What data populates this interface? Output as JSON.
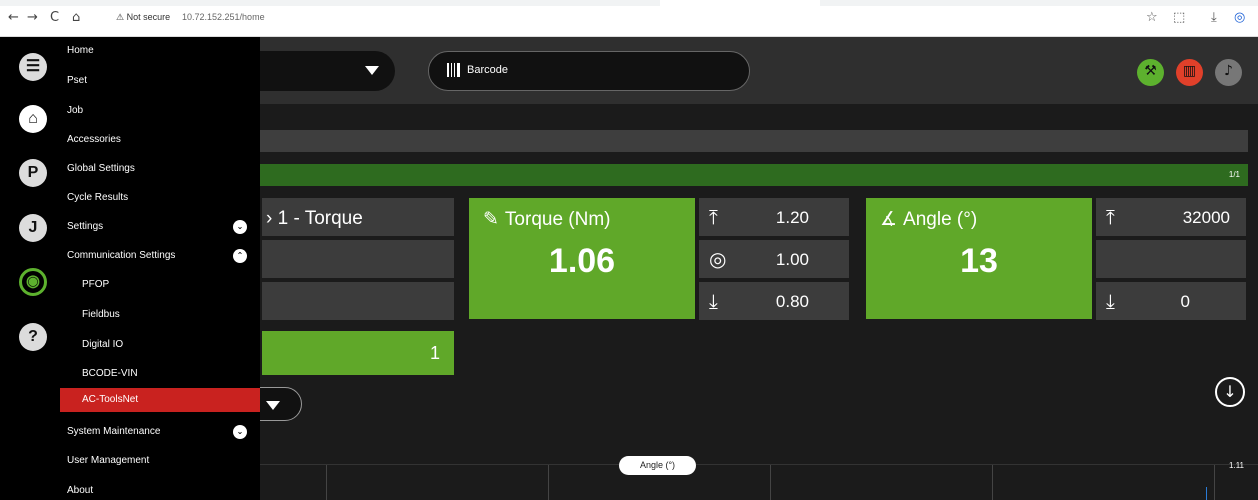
{
  "browser": {
    "back": "←",
    "forward": "→",
    "reload": "C",
    "home": "⌂",
    "security_label": "⚠ Not secure",
    "url": "10.72.152.251/home",
    "toolbar_icons": [
      "star-icon",
      "extensions-icon",
      "download-icon",
      "profile-icon"
    ]
  },
  "header": {
    "barcode_label": "Barcode"
  },
  "sidebar": {
    "rail": [
      "☰",
      "⌂",
      "P",
      "J",
      "◉",
      "?"
    ],
    "items": [
      {
        "label": "Home"
      },
      {
        "label": "Pset"
      },
      {
        "label": "Job"
      },
      {
        "label": "Accessories"
      },
      {
        "label": "Global Settings"
      },
      {
        "label": "Cycle Results"
      },
      {
        "label": "Settings"
      },
      {
        "label": "Communication Settings"
      },
      {
        "label": "PFOP"
      },
      {
        "label": "Fieldbus"
      },
      {
        "label": "Digital IO"
      },
      {
        "label": "BCODE-VIN"
      },
      {
        "label": "AC-ToolsNet"
      },
      {
        "label": "System Maintenance"
      },
      {
        "label": "User Management"
      },
      {
        "label": "About"
      }
    ]
  },
  "progress": {
    "count": "1/1"
  },
  "pset": {
    "title": "1 - Torque",
    "batch_count": "1"
  },
  "torque": {
    "label": "Torque (Nm)",
    "value": "1.06",
    "max": "1.20",
    "target": "1.00",
    "min": "0.80"
  },
  "angle": {
    "label": "Angle (°)",
    "value": "13",
    "max": "32000",
    "min": "0"
  },
  "chart": {
    "toggle_label": "Angle (°)",
    "y_tick": "1.11"
  },
  "colors": {
    "accent_green": "#60a829",
    "active_red": "#c9221f",
    "status_tool": "#5db12e",
    "status_factory": "#e0402a",
    "status_bell": "#777777"
  }
}
